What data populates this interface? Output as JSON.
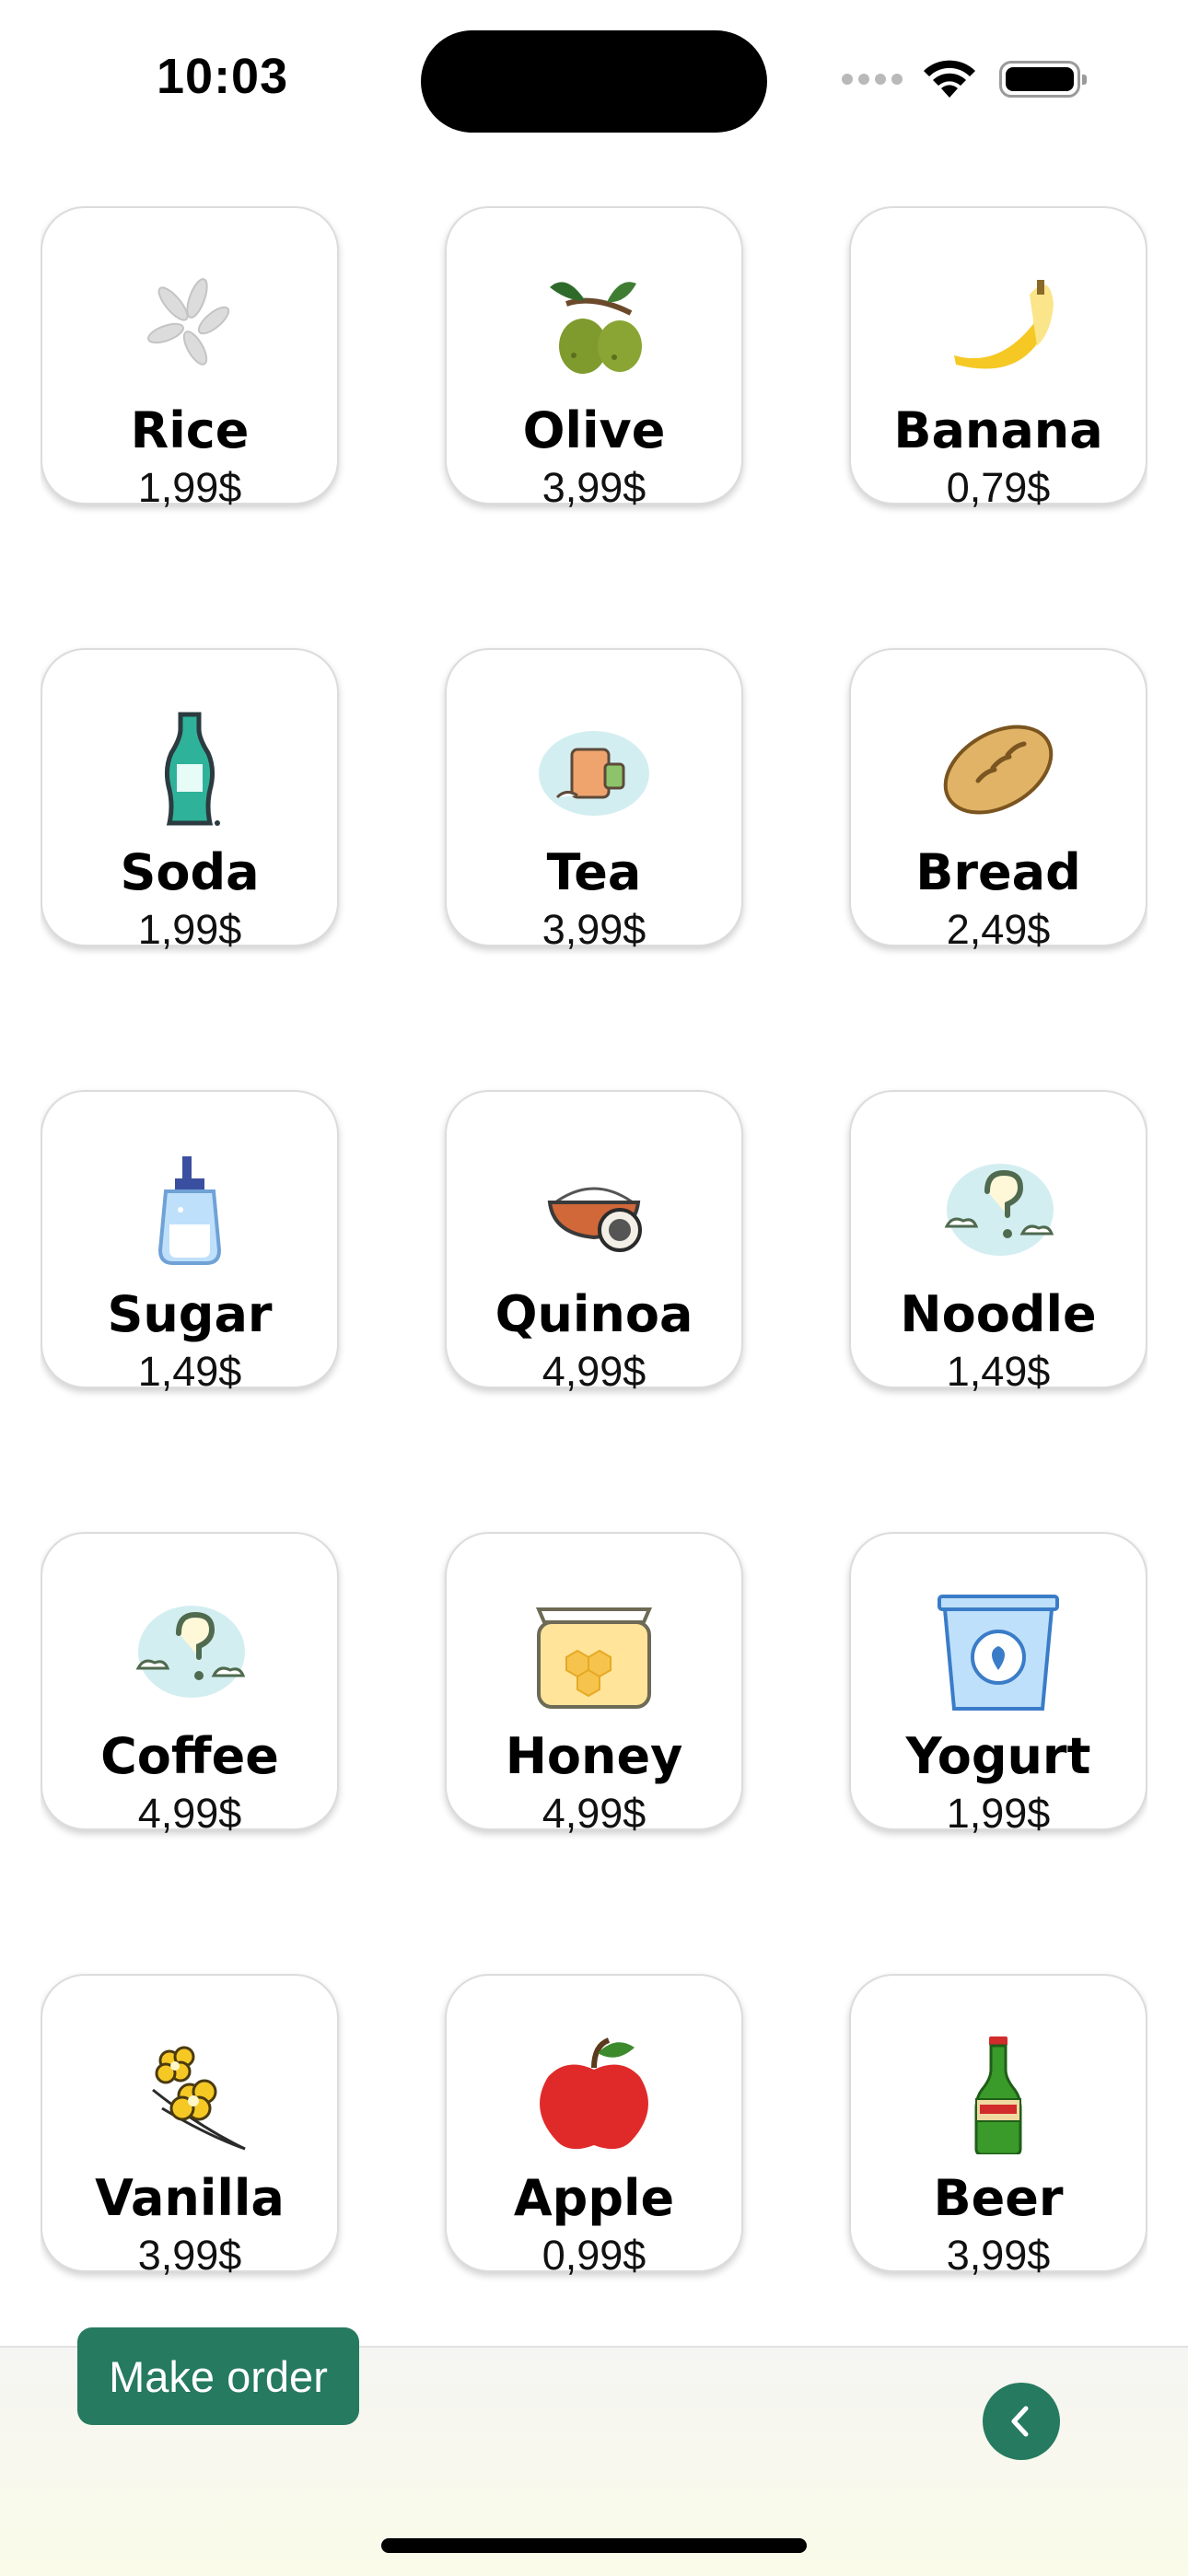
{
  "status_bar": {
    "time": "10:03"
  },
  "products": [
    {
      "name": "Rice",
      "price": "1,99$",
      "icon": "rice-icon"
    },
    {
      "name": "Olive",
      "price": "3,99$",
      "icon": "olive-icon"
    },
    {
      "name": "Banana",
      "price": "0,79$",
      "icon": "banana-icon"
    },
    {
      "name": "Soda",
      "price": "1,99$",
      "icon": "soda-bottle-icon"
    },
    {
      "name": "Tea",
      "price": "3,99$",
      "icon": "tea-bag-icon"
    },
    {
      "name": "Bread",
      "price": "2,49$",
      "icon": "bread-icon"
    },
    {
      "name": "Sugar",
      "price": "1,49$",
      "icon": "sugar-dispenser-icon"
    },
    {
      "name": "Quinoa",
      "price": "4,99$",
      "icon": "quinoa-bowl-icon"
    },
    {
      "name": "Noodle",
      "price": "1,49$",
      "icon": "question-cloud-icon"
    },
    {
      "name": "Coffee",
      "price": "4,99$",
      "icon": "question-cloud-icon"
    },
    {
      "name": "Honey",
      "price": "4,99$",
      "icon": "honey-jar-icon"
    },
    {
      "name": "Yogurt",
      "price": "1,99$",
      "icon": "yogurt-cup-icon"
    },
    {
      "name": "Vanilla",
      "price": "3,99$",
      "icon": "vanilla-flower-icon"
    },
    {
      "name": "Apple",
      "price": "0,99$",
      "icon": "apple-icon"
    },
    {
      "name": "Beer",
      "price": "3,99$",
      "icon": "beer-bottle-icon"
    }
  ],
  "bottom_bar": {
    "order_label": "Make order",
    "back_icon": "chevron-left-icon"
  },
  "colors": {
    "accent": "#267a5f"
  }
}
